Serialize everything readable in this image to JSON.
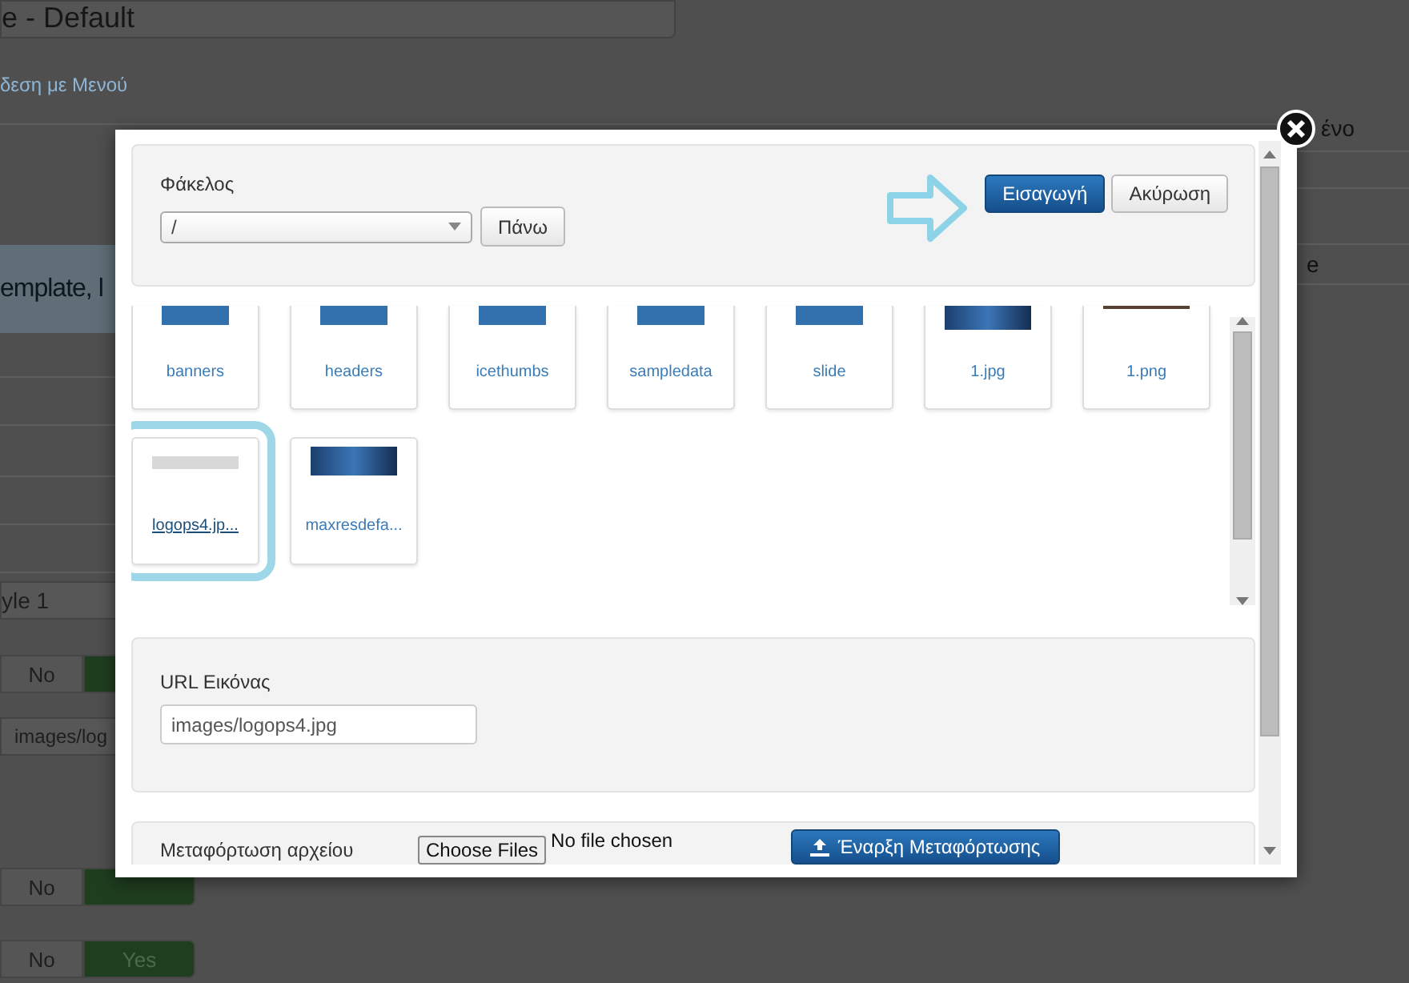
{
  "background": {
    "title_field": "e - Default",
    "menu_link": "δεση με Μενού",
    "banner": "emplate, l",
    "style_field": "yle 1",
    "image_field": "images/log",
    "right_labels": [
      "ένο",
      "e"
    ],
    "toggles": [
      {
        "options": [
          {
            "label": "No",
            "selected": false
          },
          {
            "selected": true
          }
        ]
      },
      {
        "options": [
          {
            "label": "No",
            "selected": false
          },
          {
            "selected": true
          }
        ]
      },
      {
        "options": [
          {
            "label": "No",
            "selected": false
          },
          {
            "label": "Yes",
            "selected": true
          }
        ]
      }
    ]
  },
  "modal": {
    "folder_label": "Φάκελος",
    "folder_select": "/",
    "up_button": "Πάνω",
    "insert_button": "Εισαγωγή",
    "cancel_button": "Ακύρωση",
    "files": [
      {
        "name": "banners",
        "kind": "folder",
        "selected": false
      },
      {
        "name": "headers",
        "kind": "folder",
        "selected": false
      },
      {
        "name": "icethumbs",
        "kind": "folder",
        "selected": false
      },
      {
        "name": "sampledata",
        "kind": "folder",
        "selected": false
      },
      {
        "name": "slide",
        "kind": "folder",
        "selected": false
      },
      {
        "name": "1.jpg",
        "kind": "image",
        "selected": false
      },
      {
        "name": "1.png",
        "kind": "strip",
        "selected": false
      },
      {
        "name": "logops4.jp...",
        "kind": "logo",
        "selected": true
      },
      {
        "name": "maxresdefa...",
        "kind": "image",
        "selected": false
      }
    ],
    "url_label": "URL Εικόνας",
    "url_value": "images/logops4.jpg",
    "upload_label": "Μεταφόρτωση αρχείου",
    "choose_button": "Choose Files",
    "no_file": "No file chosen",
    "start_upload": "Έναρξη Μεταφόρτωσης"
  }
}
